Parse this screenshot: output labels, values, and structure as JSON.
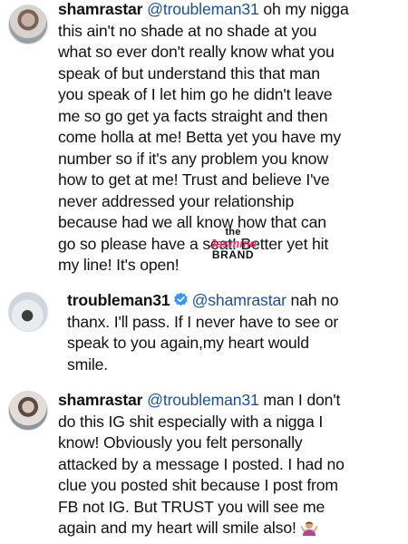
{
  "comments": [
    {
      "username": "shamrastar",
      "mention": "@troubleman31",
      "lines": [
        " oh my nigga",
        "this ain't no shade at no shade at you",
        "what so ever don't really know what you",
        "speak of but understand this that man",
        "you speak of I let him go he didn't leave",
        "me so go get ya facts straight and then",
        "come holla at me! Betta yet you have my",
        "number so if it's any problem you know",
        "how to get at me! Trust and believe I've",
        "never addressed your relationship",
        "because had we all know how that can",
        "go so please have a seat! Better yet hit",
        "my line! It's open!"
      ]
    },
    {
      "username": "troubleman31",
      "verified": true,
      "mention": "@shamrastar",
      "lines": [
        " nah no",
        "thanx. I'll pass. If I never have to see or",
        "speak to you again,my heart would",
        "smile."
      ]
    },
    {
      "username": "shamrastar",
      "mention": "@troubleman31",
      "lines": [
        " man I don't",
        "do this IG shit especially with a nigga I",
        "know! Obviously you felt personally",
        "attacked by a message I posted. I had no",
        "clue you posted shit because I post from",
        "FB not IG. But TRUST you will see me",
        "again and my heart will smile also!"
      ],
      "emoji": "person-shrugging-emoji"
    }
  ],
  "watermark": {
    "top": "the",
    "middle": "Jasmine",
    "bottom": "BRAND"
  },
  "colors": {
    "mention": "#1d4f91",
    "verified_badge": "#3897f0",
    "watermark_accent": "#e0336b",
    "text": "#111111"
  }
}
